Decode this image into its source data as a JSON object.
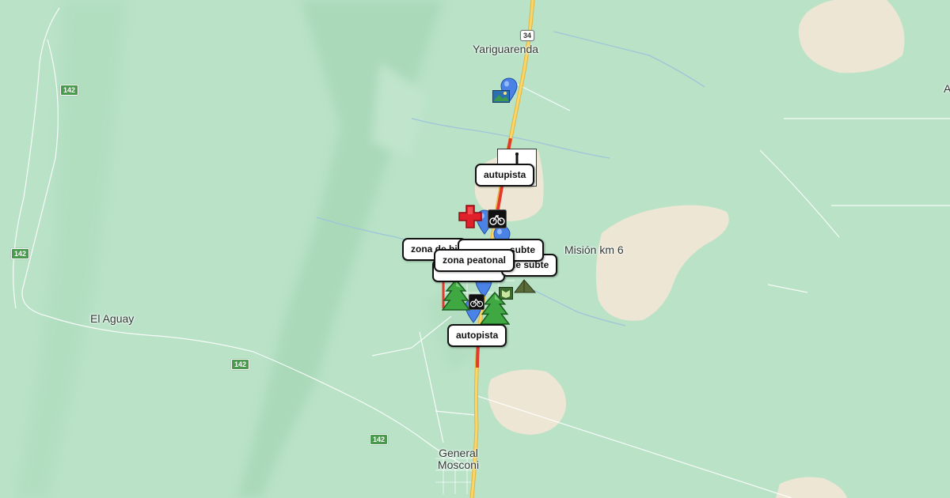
{
  "map": {
    "colors": {
      "land": "#b9e2c7",
      "bare_ground": "#ede6d4",
      "highway": "#f4c542",
      "traffic_red": "#e23b2e",
      "water": "#9ec5d9",
      "roads": "#ffffff"
    },
    "places": {
      "yariguarenda": "Yariguarenda",
      "mision_km6": "Misión km 6",
      "el_aguay": "El Aguay",
      "general_mosconi": "General\nMosconi",
      "edge_letter": "A"
    },
    "road_shields": {
      "r34": "34",
      "r142_a": "142",
      "r142_b": "142",
      "r142_c": "142",
      "r142_d": "142"
    },
    "callouts": {
      "autopista_top": "autupista",
      "zona_top": "zona de bi",
      "subte_a": "subte",
      "subte_b": "de subte",
      "zona_peatonal": "zona peatonal",
      "autopista_bottom": "autopista"
    },
    "icons": [
      "location-pin-icon",
      "red-cross-icon",
      "bicycle-icon",
      "tree-icon",
      "tent-icon",
      "photo-icon"
    ]
  }
}
